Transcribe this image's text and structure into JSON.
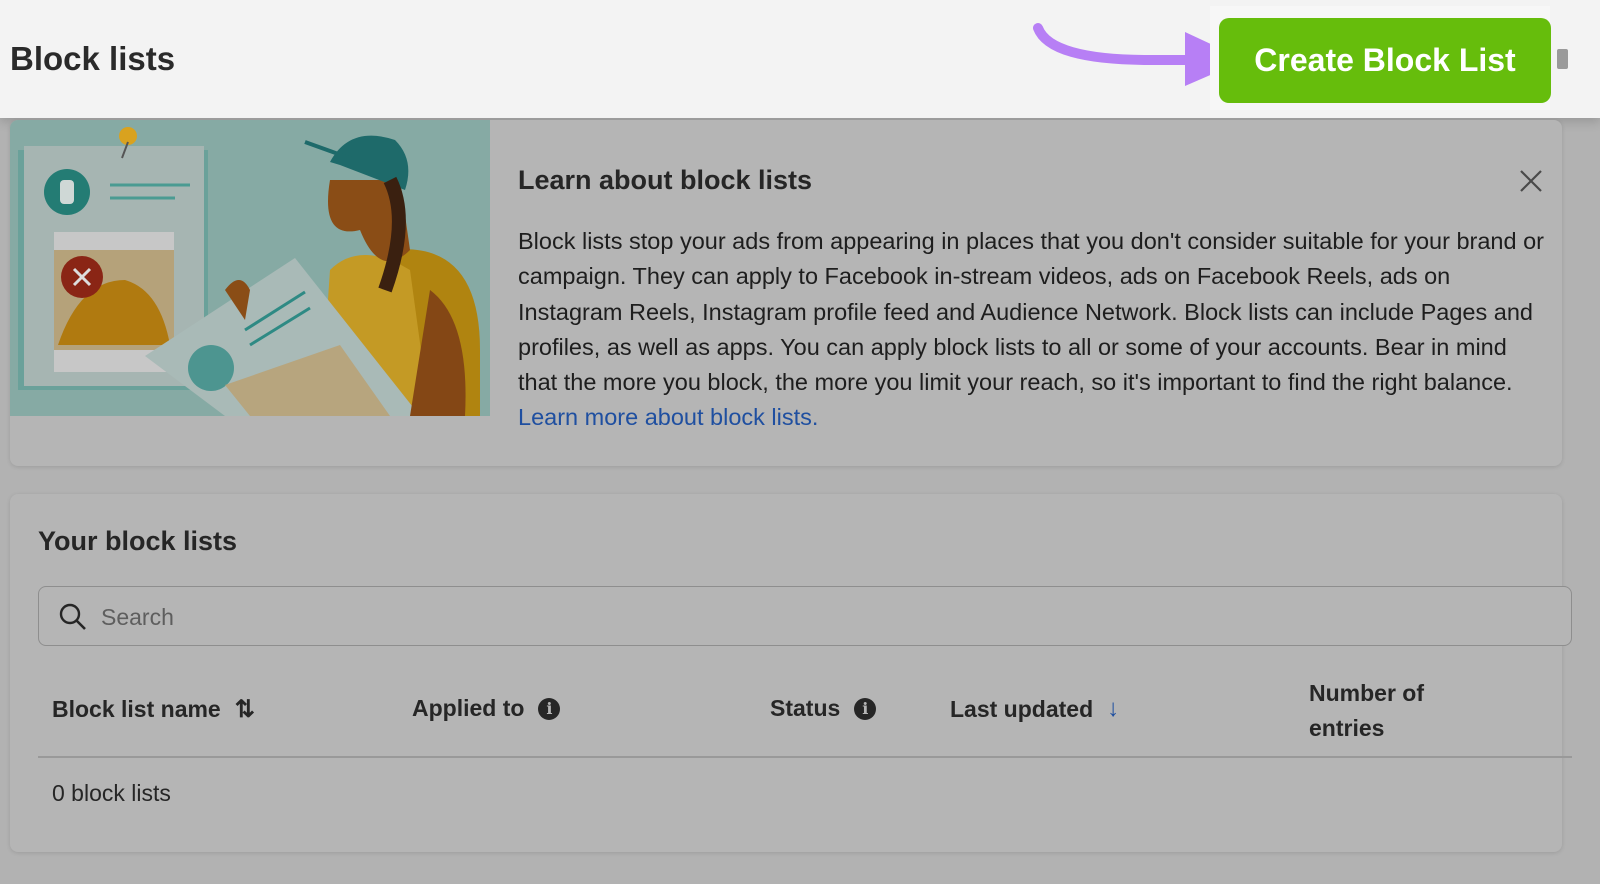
{
  "header": {
    "title": "Block lists",
    "create_button": "Create Block List"
  },
  "learn": {
    "title": "Learn about block lists",
    "body": "Block lists stop your ads from appearing in places that you don't consider suitable for your brand or campaign. They can apply to Facebook in-stream videos, ads on Facebook Reels, ads on Instagram Reels, Instagram profile feed and Audience Network. Block lists can include Pages and profiles, as well as apps. You can apply block lists to all or some of your accounts. Bear in mind that the more you block, the more you limit your reach, so it's important to find the right balance.",
    "link": "Learn more about block lists."
  },
  "lists": {
    "title": "Your block lists",
    "search_placeholder": "Search",
    "columns": [
      "Block list name",
      "Applied to",
      "Status",
      "Last updated",
      "Number of entries"
    ],
    "empty_text": "0 block lists"
  },
  "colors": {
    "button": "#66bd0c",
    "arrow": "#b77ff5",
    "link": "#1f4fa0"
  }
}
